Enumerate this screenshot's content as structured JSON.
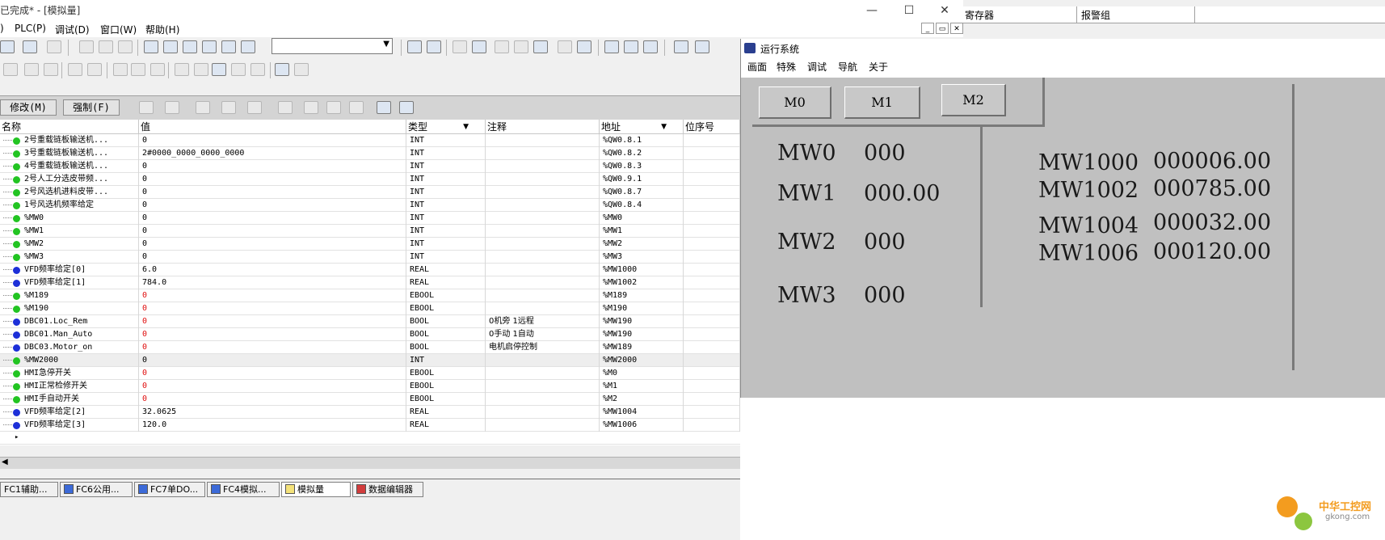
{
  "window": {
    "title": "已完成* - [模拟量]"
  },
  "menu": [
    "PLC(P)",
    "调试(D)",
    "窗口(W)",
    "帮助(H)"
  ],
  "right_headers": [
    "寄存器",
    "报警组"
  ],
  "sim_buttons": {
    "modify": "修改(M)",
    "force": "强制(F)"
  },
  "columns": [
    "名称",
    "值",
    "类型",
    "注释",
    "地址",
    "位序号"
  ],
  "rows": [
    {
      "name": "2号重载链板输送机...",
      "value": "0",
      "type": "INT",
      "comment": "",
      "addr": "%QW0.8.1",
      "dot": "green",
      "red": false
    },
    {
      "name": "3号重载链板输送机...",
      "value": "2#0000_0000_0000_0000",
      "type": "INT",
      "comment": "",
      "addr": "%QW0.8.2",
      "dot": "green",
      "red": false
    },
    {
      "name": "4号重载链板输送机...",
      "value": "0",
      "type": "INT",
      "comment": "",
      "addr": "%QW0.8.3",
      "dot": "green",
      "red": false
    },
    {
      "name": "2号人工分选皮带频...",
      "value": "0",
      "type": "INT",
      "comment": "",
      "addr": "%QW0.9.1",
      "dot": "green",
      "red": false
    },
    {
      "name": "2号风选机进料皮带...",
      "value": "0",
      "type": "INT",
      "comment": "",
      "addr": "%QW0.8.7",
      "dot": "green",
      "red": false
    },
    {
      "name": "1号风选机频率给定",
      "value": "0",
      "type": "INT",
      "comment": "",
      "addr": "%QW0.8.4",
      "dot": "green",
      "red": false
    },
    {
      "name": "%MW0",
      "value": "0",
      "type": "INT",
      "comment": "",
      "addr": "%MW0",
      "dot": "green",
      "red": false
    },
    {
      "name": "%MW1",
      "value": "0",
      "type": "INT",
      "comment": "",
      "addr": "%MW1",
      "dot": "green",
      "red": false
    },
    {
      "name": "%MW2",
      "value": "0",
      "type": "INT",
      "comment": "",
      "addr": "%MW2",
      "dot": "green",
      "red": false
    },
    {
      "name": "%MW3",
      "value": "0",
      "type": "INT",
      "comment": "",
      "addr": "%MW3",
      "dot": "green",
      "red": false
    },
    {
      "name": "VFD频率给定[0]",
      "value": "6.0",
      "type": "REAL",
      "comment": "",
      "addr": "%MW1000",
      "dot": "blue",
      "red": false
    },
    {
      "name": "VFD频率给定[1]",
      "value": "784.0",
      "type": "REAL",
      "comment": "",
      "addr": "%MW1002",
      "dot": "blue",
      "red": false
    },
    {
      "name": "%M189",
      "value": "0",
      "type": "EBOOL",
      "comment": "",
      "addr": "%M189",
      "dot": "green",
      "red": true
    },
    {
      "name": "%M190",
      "value": "0",
      "type": "EBOOL",
      "comment": "",
      "addr": "%M190",
      "dot": "green",
      "red": true
    },
    {
      "name": "DBC01.Loc_Rem",
      "value": "0",
      "type": "BOOL",
      "comment": "0机旁 1远程",
      "addr": "%MW190",
      "dot": "blue",
      "red": true
    },
    {
      "name": "DBC01.Man_Auto",
      "value": "0",
      "type": "BOOL",
      "comment": "0手动 1自动",
      "addr": "%MW190",
      "dot": "blue",
      "red": true
    },
    {
      "name": "DBC03.Motor_on",
      "value": "0",
      "type": "BOOL",
      "comment": "电机启停控制",
      "addr": "%MW189",
      "dot": "blue",
      "red": true
    },
    {
      "name": "%MW2000",
      "value": "0",
      "type": "INT",
      "comment": "",
      "addr": "%MW2000",
      "dot": "green",
      "red": false
    },
    {
      "name": "HMI急停开关",
      "value": "0",
      "type": "EBOOL",
      "comment": "",
      "addr": "%M0",
      "dot": "green",
      "red": true
    },
    {
      "name": "HMI正常检修开关",
      "value": "0",
      "type": "EBOOL",
      "comment": "",
      "addr": "%M1",
      "dot": "green",
      "red": true
    },
    {
      "name": "HMI手自动开关",
      "value": "0",
      "type": "EBOOL",
      "comment": "",
      "addr": "%M2",
      "dot": "green",
      "red": true
    },
    {
      "name": "VFD频率给定[2]",
      "value": "32.0625",
      "type": "REAL",
      "comment": "",
      "addr": "%MW1004",
      "dot": "blue",
      "red": false
    },
    {
      "name": "VFD频率给定[3]",
      "value": "120.0",
      "type": "REAL",
      "comment": "",
      "addr": "%MW1006",
      "dot": "blue",
      "red": false
    }
  ],
  "tabs": [
    "FC1辅助...",
    "FC6公用...",
    "FC7单DO...",
    "FC4模拟...",
    "模拟量",
    "数据编辑器"
  ],
  "runtime": {
    "title": "运行系统",
    "menu": [
      "画面",
      "特殊",
      "调试",
      "导航",
      "关于"
    ],
    "buttons": [
      "M0",
      "M1",
      "M2"
    ],
    "left_items": [
      {
        "label": "MW0",
        "value": "000"
      },
      {
        "label": "MW1",
        "value": "000.00"
      },
      {
        "label": "MW2",
        "value": "000"
      },
      {
        "label": "MW3",
        "value": "000"
      }
    ],
    "right_items": [
      {
        "label": "MW1000",
        "value": "000006.00"
      },
      {
        "label": "MW1002",
        "value": "000785.00"
      },
      {
        "label": "MW1004",
        "value": "000032.00"
      },
      {
        "label": "MW1006",
        "value": "000120.00"
      }
    ]
  },
  "watermark": {
    "line1": "中华工控网",
    "line2": "gkong.com"
  },
  "colors": {
    "dot_green": "#22c422",
    "dot_blue": "#1c2fd8",
    "red_value": "#e01010"
  }
}
